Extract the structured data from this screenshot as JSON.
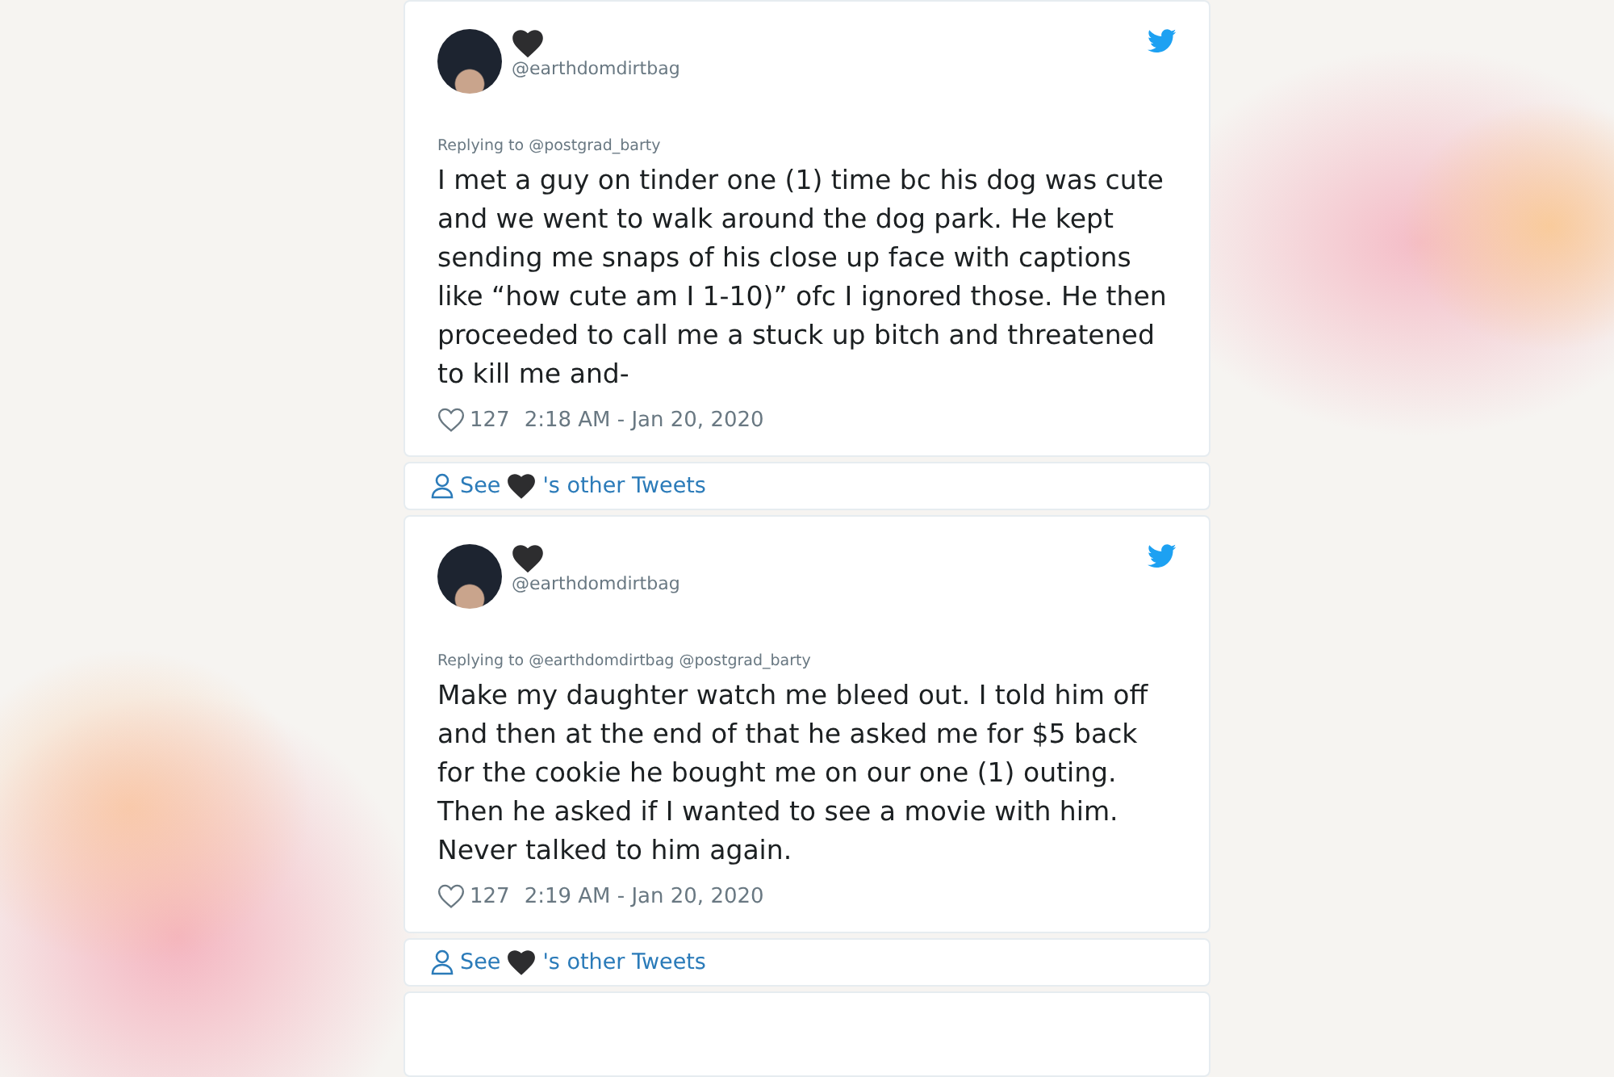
{
  "tweets": [
    {
      "handle": "@earthdomdirtbag",
      "replying_to": "Replying to @postgrad_barty",
      "text": "I met a guy on tinder one (1) time bc his dog was cute and we went to walk around the dog park. He kept sending me snaps of his close up face with captions like “how cute am I 1-10)” ofc I ignored those. He then proceeded to call me a stuck up bitch and threatened to kill me and-",
      "likes": "127",
      "timestamp": "2:18 AM - Jan 20, 2020",
      "see_prefix": "See",
      "see_suffix": "'s other Tweets"
    },
    {
      "handle": "@earthdomdirtbag",
      "replying_to": "Replying to @earthdomdirtbag @postgrad_barty",
      "text": "Make my daughter watch me bleed out. I told him off and then at the end of that he asked me for $5 back for the cookie he bought me on our one (1) outing. Then he asked if I wanted to see a movie with him.\nNever talked to him again.",
      "likes": "127",
      "timestamp": "2:19 AM - Jan 20, 2020",
      "see_prefix": "See",
      "see_suffix": "'s other Tweets"
    }
  ]
}
